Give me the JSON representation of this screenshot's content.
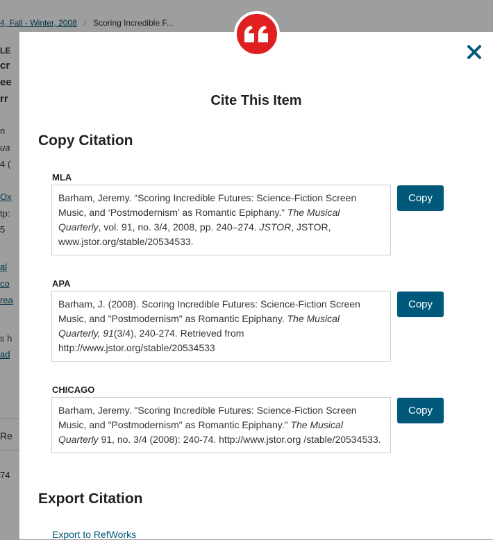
{
  "background": {
    "breadcrumb": {
      "link": "4, Fall - Winter, 2008",
      "separator": "/",
      "current": "Scoring Incredible F..."
    },
    "fragments": [
      "LE",
      "cr",
      "ee",
      "rr",
      "n",
      "ua",
      "4 (",
      "Ox",
      "tp:",
      "5",
      "al",
      "co",
      "rea",
      "s h",
      "ad",
      "Re",
      "74"
    ]
  },
  "modal": {
    "title": "Cite This Item",
    "copy_section": "Copy Citation",
    "export_section": "Export Citation",
    "export_link": "Export to RefWorks",
    "copy_label": "Copy",
    "citations": [
      {
        "style": "MLA",
        "segments": [
          {
            "t": "Barham, Jeremy. “Scoring Incredible Futures: Science-Fiction Screen Music, and ‘Postmodernism’ as Romantic Epiphany.” ",
            "i": false
          },
          {
            "t": "The Musical Quarterly",
            "i": true
          },
          {
            "t": ", vol. 91, no. 3/4, 2008, pp. 240–274. ",
            "i": false
          },
          {
            "t": "JSTOR",
            "i": true
          },
          {
            "t": ", JSTOR, www.jstor.org/stable/20534533.",
            "i": false
          }
        ]
      },
      {
        "style": "APA",
        "segments": [
          {
            "t": "Barham, J. (2008). Scoring Incredible Futures: Science-Fiction Screen Music, and \"Postmodernism\" as Romantic Epiphany. ",
            "i": false
          },
          {
            "t": "The Musical Quarterly, 91",
            "i": true
          },
          {
            "t": "(3/4), 240-274. Retrieved from http://www.jstor.org/stable/20534533",
            "i": false
          }
        ]
      },
      {
        "style": "CHICAGO",
        "segments": [
          {
            "t": "Barham, Jeremy. \"Scoring Incredible Futures: Science-Fiction Screen Music, and \"Postmodernism\" as Romantic Epiphany.\" ",
            "i": false
          },
          {
            "t": "The Musical Quarterly",
            "i": true
          },
          {
            "t": " 91, no. 3/4 (2008): 240-74. http://www.jstor.org /stable/20534533.",
            "i": false
          }
        ]
      }
    ]
  },
  "colors": {
    "accent": "#00587a",
    "badge": "#e02020"
  },
  "icons": {
    "badge": "quote-icon",
    "close": "close-icon"
  }
}
